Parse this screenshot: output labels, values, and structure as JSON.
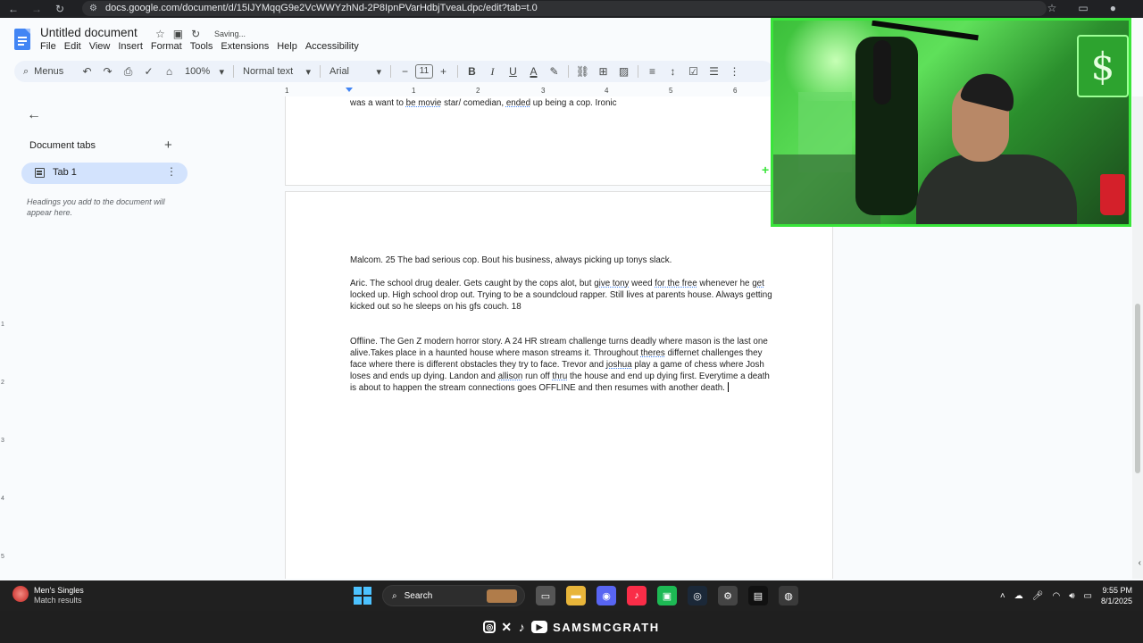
{
  "browser": {
    "url": "docs.google.com/document/d/15IJYMqqG9e2VcWWYzhNd-2P8IpnPVarHdbjTveaLdpc/edit?tab=t.0"
  },
  "docs": {
    "title": "Untitled document",
    "status": "Saving...",
    "menus": [
      "File",
      "Edit",
      "View",
      "Insert",
      "Format",
      "Tools",
      "Extensions",
      "Help",
      "Accessibility"
    ],
    "toolbar": {
      "menus_label": "Menus",
      "zoom": "100%",
      "style": "Normal text",
      "font": "Arial",
      "font_size": "11"
    },
    "ruler": [
      "1",
      "1",
      "2",
      "3",
      "4",
      "5",
      "6"
    ],
    "vruler": [
      "1",
      "2",
      "3",
      "4",
      "5"
    ]
  },
  "left_panel": {
    "header": "Document tabs",
    "tab_label": "Tab 1",
    "hint": "Headings you add to the document will appear here."
  },
  "document": {
    "page1_text_a": "was a want to ",
    "page1_text_b": "be movie",
    "page1_text_c": " star/ comedian, ",
    "page1_text_d": "ended",
    "page1_text_e": " up being a cop. Ironic",
    "para1": "Malcom. 25 The bad serious cop. Bout his business, always picking up tonys slack.",
    "para2_a": "Aric. The school drug dealer. Gets caught by the cops alot, but ",
    "para2_b": "give tony",
    "para2_c": " weed ",
    "para2_d": "for the free",
    "para2_e": " whenever he ",
    "para2_f": "get",
    "para2_g": " locked up. High school drop out. Trying to be a soundcloud rapper. Still lives at parents house. Always getting kicked out so he sleeps on his gfs couch. 18",
    "para3_a": "Offline. The Gen Z modern horror story. A 24 HR stream challenge turns deadly where mason is the last one alive.Takes place in a haunted house where mason streams it. Throughout ",
    "para3_b": "theres",
    "para3_c": " differnet challenges they face where there is different obstacles they try to face. Trevor and ",
    "para3_d": "joshua",
    "para3_e": " play a game of chess where Josh loses and ends up dying. Landon and ",
    "para3_f": "allison",
    "para3_g": " run off ",
    "para3_h": "thru",
    "para3_i": " the house and end up dying first. Everytime a death is about to happen the stream connections goes OFFLINE and then resumes with another death. "
  },
  "taskbar": {
    "news_title": "Men's Singles",
    "news_sub": "Match results",
    "search": "Search",
    "time": "9:55 PM",
    "date": "8/1/2025"
  },
  "brand": {
    "name": "SAMSMCGRATH"
  },
  "colors": {
    "accent": "#4285f4",
    "webcam_border": "#39e53a",
    "tab_selected": "#d3e3fd"
  }
}
